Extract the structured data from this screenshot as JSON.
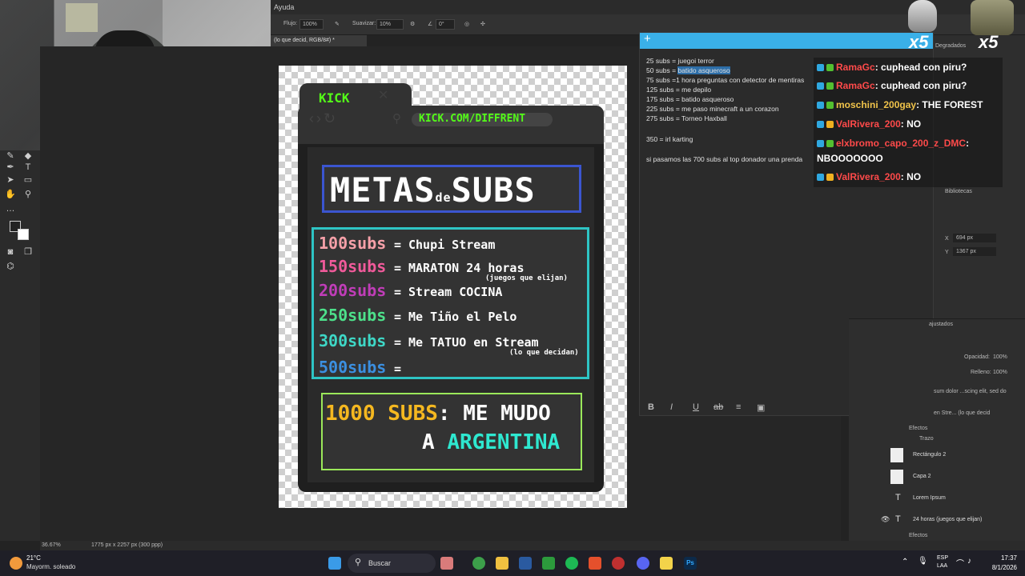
{
  "menubar": {
    "ayuda": "Ayuda"
  },
  "optionsbar": {
    "flujo_label": "Flujo:",
    "flujo_value": "100%",
    "suavizar_label": "Suavizar:",
    "suavizar_value": "10%",
    "angle_value": "0°"
  },
  "document": {
    "tab_title": "(lo que decid, RGB/8#) *",
    "zoom": "36.67%",
    "doc_info": "1775 px x 2257 px (300 ppp)"
  },
  "design": {
    "browser_tab": "KICK",
    "url": "KICK.COM/DIFFRENT",
    "title_a": "METAS",
    "title_de": "de",
    "title_b": "SUBS",
    "goals": [
      {
        "num": "100subs",
        "desc": "= Chupi Stream",
        "color": "#f5a0a8"
      },
      {
        "num": "150subs",
        "desc": "= MARATON 24 horas",
        "sub": "(juegos que elijan)",
        "color": "#f05a9a"
      },
      {
        "num": "200subs",
        "desc": "= Stream COCINA",
        "color": "#c03db8"
      },
      {
        "num": "250subs",
        "desc": "= Me Tiño el Pelo",
        "color": "#4de08a"
      },
      {
        "num": "300subs",
        "desc": "= Me TATUO en Stream",
        "sub": "(lo que decidan)",
        "color": "#3ed7c6"
      },
      {
        "num": "500subs",
        "desc": "=",
        "color": "#3b8fe0"
      }
    ],
    "big_goal_num": "1000 SUBS",
    "big_goal_colon": ":",
    "big_goal_text1": "ME MUDO",
    "big_goal_a": "A",
    "big_goal_country": "ARGENTINA"
  },
  "notes": {
    "lines": [
      "25 subs = juegoi terror",
      "50 subs = batido asqueroso",
      "75 subs =1 hora preguntas con detector de mentiras",
      "125 subs = me depilo",
      "175 subs = batido asqueroso",
      "225 subs = me paso minecraft a un corazon",
      "275 subs = Torneo Haxball",
      "350 = irl karting",
      "si pasamos las 700 subs al top donador una prenda"
    ],
    "line2_prefix": "50 subs = ",
    "line2_selected": "batido asqueroso",
    "format_icons": [
      "B",
      "I",
      "U",
      "ab",
      "≡",
      "▣"
    ]
  },
  "chat": {
    "messages": [
      {
        "user": "RamaGc",
        "text": ": cuphead con piru?",
        "user_color": "#ff4a4a"
      },
      {
        "user": "RamaGc",
        "text": ": cuphead con piru?",
        "user_color": "#ff4a4a"
      },
      {
        "user": "moschini_200gay",
        "text": ": THE FOREST",
        "user_color": "#f0c34a"
      },
      {
        "user": "ValRivera_200",
        "text": ": NO",
        "user_color": "#ff4a4a"
      },
      {
        "user": "elxbromo_capo_200_z_DMC",
        "text": ":",
        "user_color": "#ff4a4a"
      },
      {
        "user": "",
        "text": "NBOOOOOOO",
        "user_color": "#ffffff"
      },
      {
        "user": "ValRivera_200",
        "text": ": NO",
        "user_color": "#ff4a4a"
      }
    ],
    "x5": "x5"
  },
  "rightpanel": {
    "degradados": "Degradados",
    "bibliotecas": "Bibliotecas",
    "x_value": "694 px",
    "y_value": "1367 px",
    "x_label": "X",
    "y_label": "Y",
    "ajustados": "ajustados",
    "opacidad_label": "Opacidad:",
    "opacidad_value": "100%",
    "relleno_label": "Relleno:",
    "relleno_value": "100%",
    "lorem_partial": "sum dolor ...scing elit, sed do",
    "layer_partial": "en Stre...   (lo que decid",
    "efectos": "Efectos",
    "trazo": "Trazo",
    "layers": [
      "Rectángulo 2",
      "Capa 2",
      "Lorem Ipsum",
      "24 horas (juegos que elijan)"
    ],
    "efectos2": "Efectos"
  },
  "taskbar": {
    "temp": "21°C",
    "weather": "Mayorm. soleado",
    "search": "Buscar",
    "lang1": "ESP",
    "lang2": "LAA",
    "time": "17:37",
    "date": "8/1/2026"
  },
  "colors": {
    "kick_green": "#53fc18",
    "notes_header": "#3ab0e8",
    "title_border": "#3b55d0",
    "goals_border": "#2ec4c4"
  }
}
